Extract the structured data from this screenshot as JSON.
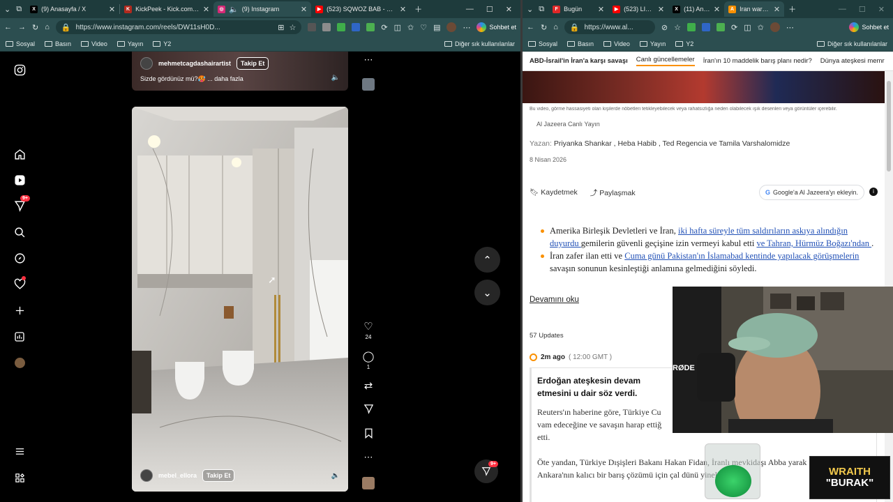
{
  "left_window": {
    "tabs": [
      {
        "title": "(9) Anasayfa / X",
        "icon": "x-icon",
        "color": "#000000",
        "glyph": "X"
      },
      {
        "title": "KickPeek - Kick.com için Gel",
        "icon": "kickpeek-icon",
        "color": "#b22a1e",
        "glyph": "K"
      },
      {
        "title": "(9) Instagram",
        "icon": "instagram-icon",
        "color": "#d62976",
        "glyph": "◎"
      },
      {
        "title": "(523) SQWOZ BAB - ПЫХ П",
        "icon": "youtube-icon",
        "color": "#ff0000",
        "glyph": "▶"
      }
    ],
    "url": "https://www.instagram.com/reels/DW11sH0D...",
    "chat_label": "Sohbet et",
    "bookmarks": [
      "Sosyal",
      "Basın",
      "Video",
      "Yayın",
      "Y2"
    ],
    "other_bookmarks": "Diğer sık kullanılanlar"
  },
  "right_window": {
    "tabs": [
      {
        "title": "Bugün",
        "icon": "flipboard-icon",
        "color": "#e12828",
        "glyph": "F"
      },
      {
        "title": "(523) LIVE: V",
        "icon": "youtube-icon",
        "color": "#ff0000",
        "glyph": "▶"
      },
      {
        "title": "(11) Anasayfa",
        "icon": "x-icon",
        "color": "#000000",
        "glyph": "X"
      },
      {
        "title": "Iran war live",
        "icon": "aljazeera-icon",
        "color": "#fa9000",
        "glyph": "A"
      }
    ],
    "url": "https://www.al...",
    "chat_label": "Sohbet et",
    "bookmarks": [
      "Sosyal",
      "Basın",
      "Video",
      "Yayın",
      "Y2"
    ],
    "other_bookmarks": "Diğer sık kullanılanlar",
    "topics": [
      "ABD-İsrail'in İran'a karşı savaşı",
      "Canlı güncellemeler",
      "İran'ın 10 maddelik barış planı nedir?",
      "Dünya ateşkesi memr"
    ],
    "video_warning": "Bu video, görme hassasiyeti olan kişilerde nöbetleri tetikleyebilecek veya rahatsızlığa neden olabilecek ışık desenleri veya görüntüler içerebilir.",
    "source": "Al Jazeera Canlı Yayın",
    "author_prefix": "Yazan:",
    "authors": "Priyanka Shankar , Heba Habib , Ted Regencia ve Tamila Varshalomidze",
    "date": "8 Nisan 2026",
    "save_label": "Kaydetmek",
    "share_label": "Paylaşmak",
    "google_label": "Google'a Al Jazeera'yı ekleyin.",
    "bullets": [
      {
        "t1": "Amerika Birleşik Devletleri ve İran, ",
        "link1": "iki hafta süreyle tüm saldırıların askıya alındığın duyurdu ",
        "t2": "gemilerin güvenli geçişine izin vermeyi kabul etti ",
        "link2": "ve Tahran, Hürmüz Boğazı'ndan ",
        "t3": "."
      },
      {
        "t1": "İran zafer ilan etti ve ",
        "link1": "Cuma günü Pakistan'ın İslamabad kentinde yapılacak görüşmelerin",
        "t2": " savaşın sonunun kesinleştiği anlamına gelmediğini söyledi.",
        "link2": "",
        "t3": ""
      }
    ],
    "read_more": "Devamını oku",
    "updates_count": "57 Updates",
    "update_time": "2m ago",
    "update_gmt": "( 12:00 GMT )",
    "update_title": "Erdoğan ateşkesin devam etmesini u dair söz verdi.",
    "update_p1": "Reuters'ın haberine göre, Türkiye Cu vam edeceğine ve savaşın harap ettiğ etti.",
    "update_p2": "Öte yandan, Türkiye Dışişleri Bakanı Hakan Fidan, İranlı mevkidaşı Abba yarak Ankara'nın kalıcı bir barış çözümü için çal dünü yineled"
  },
  "instagram": {
    "top_user": "mehmetcagdashairartist",
    "top_caption": "Sizde gördünüz mü?🥵 ... daha fazla",
    "follow_label": "Takip Et",
    "bottom_user": "mebel_ellora",
    "likes": "24",
    "comments": "1",
    "notif_badge": "9+",
    "msg_badge": "9+"
  },
  "overlay": {
    "webcam_label": "RØDE",
    "logo_line1": "WRAITH",
    "logo_line2": "\"BURAK\""
  }
}
